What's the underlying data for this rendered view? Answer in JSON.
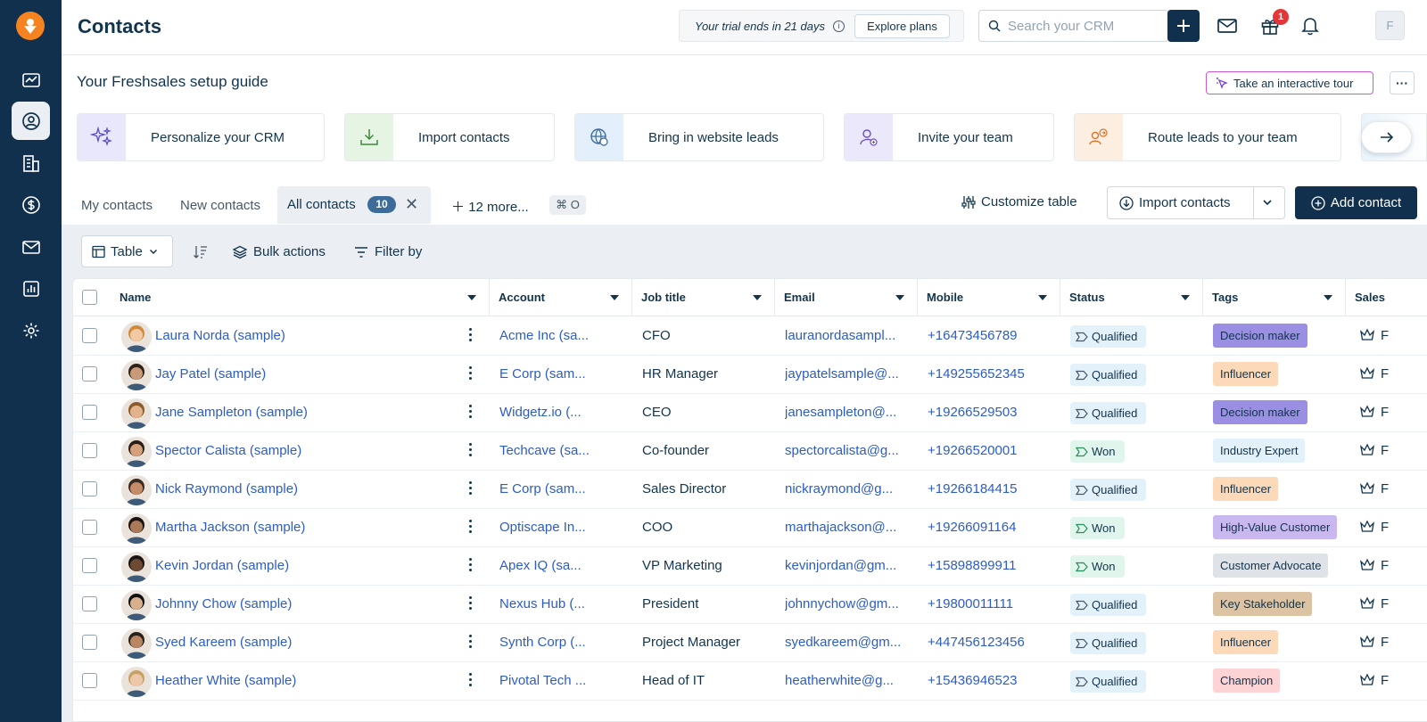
{
  "header": {
    "title": "Contacts",
    "trial_text": "Your trial ends in 21 days",
    "trial_info_icon": "i",
    "explore_label": "Explore plans",
    "search_placeholder": "Search your CRM",
    "notification_count": "1",
    "avatar_initial": "F"
  },
  "guide": {
    "title": "Your Freshsales setup guide",
    "tour_label": "Take an interactive tour",
    "more_label": "···",
    "cards": [
      {
        "label": "Personalize your CRM",
        "icon": "sparkle-icon",
        "bg": "#e9e7fb"
      },
      {
        "label": "Import contacts",
        "icon": "download-tray-icon",
        "bg": "#e6f4e4"
      },
      {
        "label": "Bring in website leads",
        "icon": "globe-cursor-icon",
        "bg": "#e3f0fb"
      },
      {
        "label": "Invite your team",
        "icon": "add-user-icon",
        "bg": "#ece8fb"
      },
      {
        "label": "Route leads to your team",
        "icon": "route-user-icon",
        "bg": "#fdeee2"
      }
    ]
  },
  "tabs": {
    "my_contacts": "My contacts",
    "new_contacts": "New contacts",
    "all_contacts": "All contacts",
    "all_count": "10",
    "more": "12 more...",
    "shortcut": "⌘ O",
    "customize": "Customize table",
    "import": "Import contacts",
    "add": "Add contact"
  },
  "toolbar": {
    "view": "Table",
    "bulk": "Bulk actions",
    "filter": "Filter by"
  },
  "table": {
    "columns": [
      "Name",
      "Account",
      "Job title",
      "Email",
      "Mobile",
      "Status",
      "Tags",
      "Sales"
    ],
    "rows": [
      {
        "name": "Laura Norda (sample)",
        "account": "Acme Inc (sa...",
        "job": "CFO",
        "email": "lauranordasampl...",
        "mobile": "+16473456789",
        "status": "Qualified",
        "tag": "Decision maker",
        "tag_color": "#9b8fe3",
        "owner": "F"
      },
      {
        "name": "Jay Patel (sample)",
        "account": "E Corp (sam...",
        "job": "HR Manager",
        "email": "jaypatelsample@...",
        "mobile": "+149255652345",
        "status": "Qualified",
        "tag": "Influencer",
        "tag_color": "#fcd9b8",
        "owner": "F"
      },
      {
        "name": "Jane Sampleton (sample)",
        "account": "Widgetz.io (...",
        "job": "CEO",
        "email": "janesampleton@...",
        "mobile": "+19266529503",
        "status": "Qualified",
        "tag": "Decision maker",
        "tag_color": "#9b8fe3",
        "owner": "F"
      },
      {
        "name": "Spector Calista (sample)",
        "account": "Techcave (sa...",
        "job": "Co-founder",
        "email": "spectorcalista@g...",
        "mobile": "+19266520001",
        "status": "Won",
        "tag": "Industry Expert",
        "tag_color": "#e3f1fb",
        "owner": "F"
      },
      {
        "name": "Nick Raymond (sample)",
        "account": "E Corp (sam...",
        "job": "Sales Director",
        "email": "nickraymond@g...",
        "mobile": "+19266184415",
        "status": "Qualified",
        "tag": "Influencer",
        "tag_color": "#fcd9b8",
        "owner": "F"
      },
      {
        "name": "Martha Jackson (sample)",
        "account": "Optiscape In...",
        "job": "COO",
        "email": "marthajackson@...",
        "mobile": "+19266091164",
        "status": "Won",
        "tag": "High-Value Customer",
        "tag_color": "#c9b8f0",
        "owner": "F"
      },
      {
        "name": "Kevin Jordan (sample)",
        "account": "Apex IQ (sa...",
        "job": "VP Marketing",
        "email": "kevinjordan@gm...",
        "mobile": "+15898899911",
        "status": "Won",
        "tag": "Customer Advocate",
        "tag_color": "#dfe3e8",
        "owner": "F"
      },
      {
        "name": "Johnny Chow (sample)",
        "account": "Nexus Hub (...",
        "job": "President",
        "email": "johnnychow@gm...",
        "mobile": "+19800011111",
        "status": "Qualified",
        "tag": "Key Stakeholder",
        "tag_color": "#dcc3a4",
        "owner": "F"
      },
      {
        "name": "Syed Kareem (sample)",
        "account": "Synth Corp (...",
        "job": "Project Manager",
        "email": "syedkareem@gm...",
        "mobile": "+447456123456",
        "status": "Qualified",
        "tag": "Influencer",
        "tag_color": "#fcd9b8",
        "owner": "F"
      },
      {
        "name": "Heather White (sample)",
        "account": "Pivotal Tech ...",
        "job": "Head of IT",
        "email": "heatherwhite@g...",
        "mobile": "+15436946523",
        "status": "Qualified",
        "tag": "Champion",
        "tag_color": "#fcd4d6",
        "owner": "F"
      }
    ]
  },
  "colors": {
    "sidebar": "#11304d",
    "link": "#2c5cc5",
    "qualified_bg": "#e3f1fb",
    "won_bg": "#e0f5ec"
  }
}
